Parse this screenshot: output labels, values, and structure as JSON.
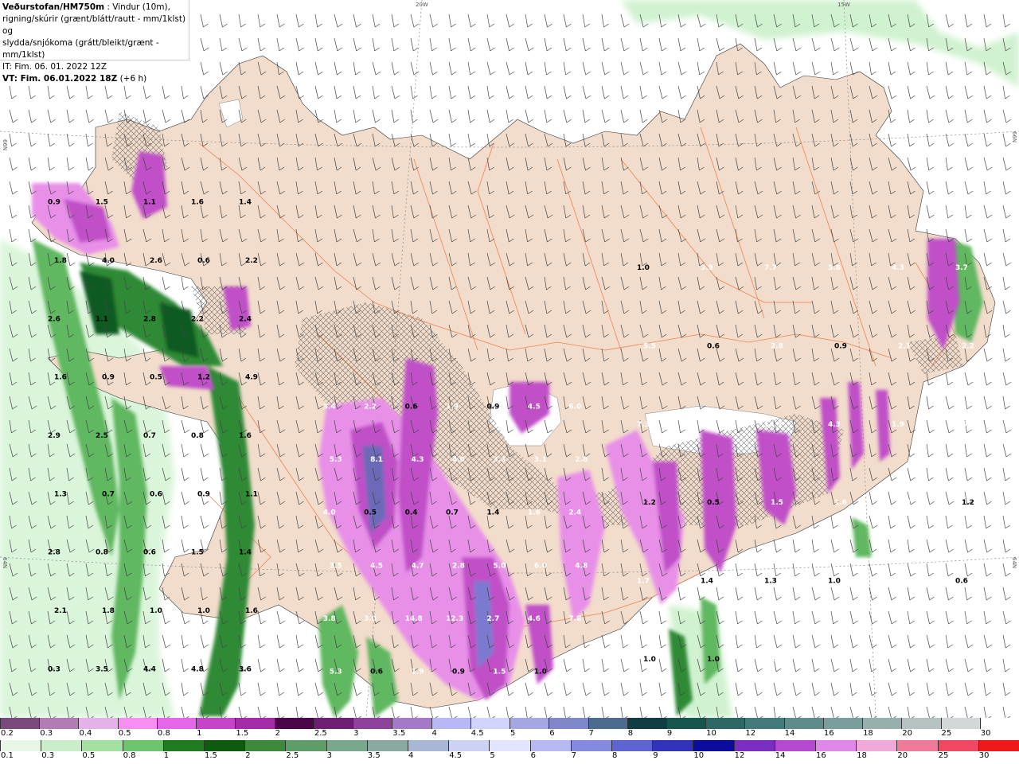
{
  "header": {
    "source_bold": "Veðurstofan/HM750m",
    "source_rest": " : Vindur (10m),",
    "line2": "rigning/skúrir (grænt/blátt/rautt - mm/1klst) og",
    "line3": "slydda/snjókoma (grátt/bleikt/grænt - mm/1klst)",
    "it_line": "IT: Fim. 06. 01. 2022 12Z",
    "vt_bold": "VT: Fim. 06.01.2022 18Z",
    "vt_rest": " (+6 h)"
  },
  "grid_labels": {
    "lon_20w": "20W",
    "lon_15w": "15W",
    "lat_66n_left": "66N",
    "lat_66n_right": "66N",
    "lat_64n_left": "64N",
    "lat_64n_right": "64N"
  },
  "colors": {
    "land": "#f2dccb",
    "sea": "#ffffff",
    "roads": "#ee7a45",
    "snow_light": "#e890e8",
    "snow_mid": "#c050c8",
    "snow_dark": "#6a1a6e",
    "rain_light": "#c8f0c8",
    "rain_mid": "#60b860",
    "rain_dark": "#115a20"
  },
  "map_values": {
    "west": [
      "0.9",
      "1.5",
      "1.1",
      "1.6",
      "1.4",
      "1.8",
      "4.0",
      "2.6",
      "0.6",
      "2.2",
      "2.6",
      "1.1",
      "2.8",
      "2.2",
      "2.4",
      "1.6",
      "0.9",
      "0.5",
      "1.2",
      "4.9",
      "2.9",
      "2.5",
      "0.7",
      "0.8",
      "1.6",
      "1.3",
      "0.7",
      "0.6",
      "0.9",
      "1.1",
      "2.8",
      "0.8",
      "0.6",
      "1.5",
      "1.4",
      "2.1",
      "1.8",
      "1.0",
      "1.0",
      "1.6",
      "0.3",
      "3.5",
      "4.4",
      "4.8",
      "3.6"
    ],
    "central": [
      "3.4",
      "2.2",
      "0.6",
      "1.9",
      "0.9",
      "4.5",
      "6.0",
      "5.3",
      "8.1",
      "4.3",
      "4.0",
      "3.3",
      "3.1",
      "2.8",
      "4.0",
      "0.5",
      "0.4",
      "0.7",
      "1.4",
      "1.6",
      "2.4",
      "3.5",
      "4.5",
      "4.7",
      "2.8",
      "5.0",
      "6.0",
      "4.8",
      "3.8",
      "3.0",
      "14.8",
      "12.3",
      "2.7",
      "4.6",
      "7.8",
      "5.3",
      "0.6",
      "1.9",
      "0.9",
      "1.5",
      "1.0"
    ],
    "east": [
      "1.0",
      "3.9",
      "7.7",
      "5.8",
      "4.3",
      "3.7",
      "5.5",
      "0.6",
      "2.8",
      "0.9",
      "2.1",
      "2.2",
      "7.3",
      "2.5",
      "14.3",
      "4.3",
      "1.9",
      "1.7",
      "1.2",
      "0.5",
      "1.5",
      "1.6",
      "2.8",
      "1.2",
      "1.7",
      "1.4",
      "1.3",
      "1.0",
      "1.7",
      "0.6",
      "1.0",
      "1.0",
      "1.7"
    ]
  },
  "legend_top": {
    "title": "",
    "labels": [
      "0.2",
      "0.3",
      "0.4",
      "0.5",
      "0.8",
      "1",
      "1.5",
      "2",
      "2.5",
      "3",
      "3.5",
      "4",
      "4.5",
      "5",
      "6",
      "7",
      "8",
      "9",
      "10",
      "12",
      "14",
      "16",
      "18",
      "20",
      "25",
      "30"
    ],
    "colors": [
      "#7a4a7c",
      "#b27cb5",
      "#e3b2e8",
      "#f78ff2",
      "#e367e8",
      "#c545c9",
      "#a52ca8",
      "#4a0646",
      "#6e1e73",
      "#8f429c",
      "#a379c8",
      "#b9b8f6",
      "#cfd4ff",
      "#a4a8e2",
      "#7f86c9",
      "#4b6c8f",
      "#103d44",
      "#15554e",
      "#2e6864",
      "#417a78",
      "#5e8c8a",
      "#7a9e9c",
      "#97b0ae",
      "#b4c3c2",
      "#d2d8d8",
      "#ffffff"
    ]
  },
  "legend_bottom": {
    "labels": [
      "0.1",
      "0.3",
      "0.5",
      "0.8",
      "1",
      "1.5",
      "2",
      "2.5",
      "3",
      "3.5",
      "4",
      "4.5",
      "5",
      "6",
      "7",
      "8",
      "9",
      "10",
      "12",
      "14",
      "16",
      "18",
      "20",
      "25",
      "30"
    ],
    "colors": [
      "#e6f7e6",
      "#c9eec9",
      "#a4e0a4",
      "#6cc46c",
      "#217c21",
      "#0f5a0f",
      "#3d8a3d",
      "#5e9e66",
      "#7aa88c",
      "#8aa9a1",
      "#a9b7d6",
      "#cbd2f4",
      "#e2e4ff",
      "#b7baf2",
      "#8589e0",
      "#5e63d2",
      "#3134b8",
      "#0a0d9c",
      "#7a2ec0",
      "#b44ad0",
      "#e088e8",
      "#f0a8d8",
      "#f07898",
      "#f04860",
      "#f01818"
    ]
  }
}
